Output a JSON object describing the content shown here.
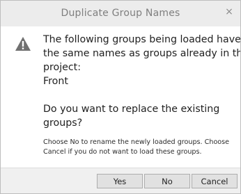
{
  "window": {
    "title": "Duplicate Group Names",
    "close_glyph": "×"
  },
  "icon": {
    "name": "warning-icon",
    "color": "#707070"
  },
  "message": {
    "lines": [
      "The following groups being loaded have",
      "the same names as groups already in the",
      "project:",
      "Front"
    ]
  },
  "question": {
    "lines": [
      "Do you want to replace the existing",
      "groups?"
    ]
  },
  "hint": {
    "lines": [
      "Choose No to rename the newly loaded groups. Choose",
      "Cancel if you do not want to load these groups."
    ]
  },
  "buttons": {
    "yes": "Yes",
    "no": "No",
    "cancel": "Cancel"
  }
}
